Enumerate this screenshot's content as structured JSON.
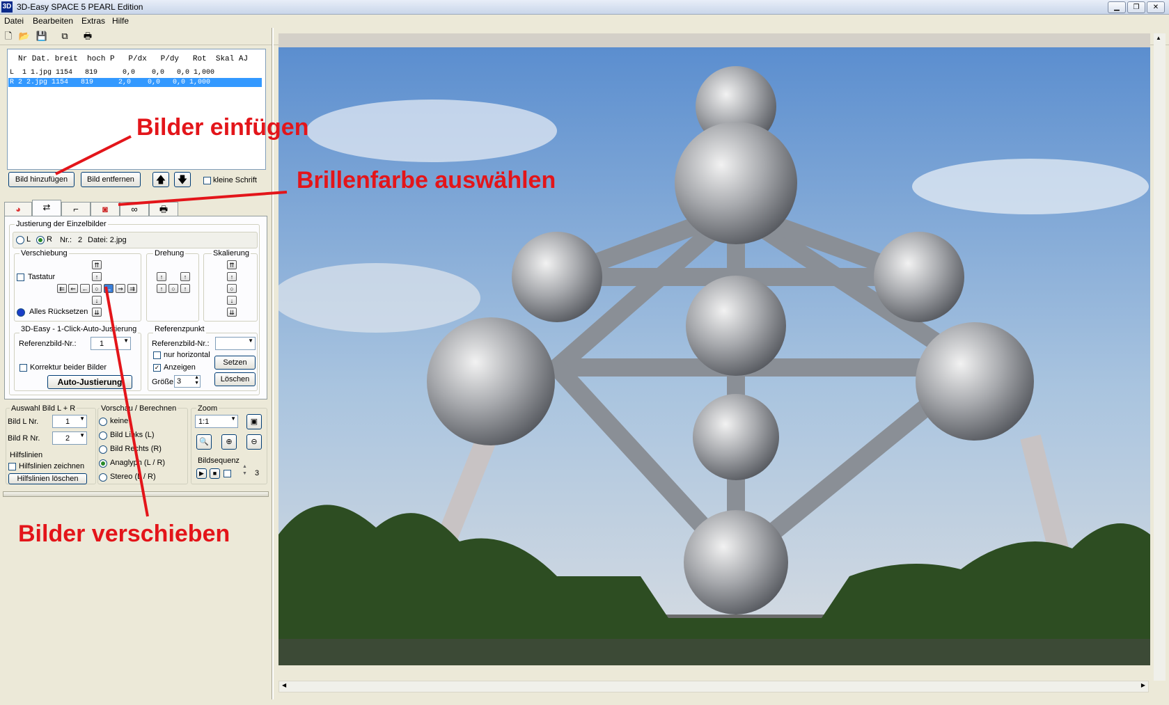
{
  "window": {
    "title": "3D-Easy SPACE 5 PEARL Edition",
    "icon_text": "3D",
    "controls": [
      "minimize-icon",
      "restore-icon",
      "close-icon"
    ]
  },
  "menu": [
    "Datei",
    "Bearbeiten",
    "Extras",
    "Hilfe"
  ],
  "toolbar": [
    "new-file-icon",
    "open-folder-icon",
    "save-icon",
    "copy-icon",
    "print-icon"
  ],
  "image_list": {
    "header": "Nr Dat. breit  hoch P   P/dx   P/dy   Rot  Skal AJ",
    "rows": [
      {
        "text": "L  1 1.jpg 1154   819      0,0    0,0   0,0 1,000",
        "selected": false
      },
      {
        "text": "R 2 2.jpg 1154   819      2,0    0,0   0,0 1,000",
        "selected": true
      }
    ]
  },
  "list_buttons": {
    "add": "Bild hinzufügen",
    "remove": "Bild entfernen",
    "small_font": "kleine Schrift"
  },
  "tabs": [
    "color-wheel-icon",
    "rotate-icon",
    "crop-icon",
    "glasses-icon",
    "stereo-icon",
    "print-icon"
  ],
  "justage": {
    "group": "Justierung der Einzelbilder",
    "radio_l": "L",
    "radio_r": "R",
    "nr_label": "Nr.:",
    "nr_value": "2",
    "file_label": "Datei: 2.jpg",
    "shift_label": "Verschiebung",
    "keyboard": "Tastatur",
    "reset_all": "Alles Rücksetzen",
    "rotation": "Drehung",
    "scaling": "Skalierung",
    "auto_group": "3D-Easy - 1-Click-Auto-Justierung",
    "ref_image_label": "Referenzbild-Nr.:",
    "ref_image_value": "1",
    "correct_both": "Korrektur beider Bilder",
    "auto_button": "Auto-Justierung",
    "refpoint_group": "Referenzpunkt",
    "ref2_label": "Referenzbild-Nr.:",
    "only_horizontal": "nur horizontal",
    "show": "Anzeigen",
    "size_label": "Größe",
    "size_value": "3",
    "set_button": "Setzen",
    "delete_button": "Löschen"
  },
  "selection": {
    "group": "Auswahl Bild L + R",
    "left_label": "Bild L  Nr.",
    "left_value": "1",
    "right_label": "Bild R  Nr.",
    "right_value": "2",
    "guides_group": "Hilfslinien",
    "guides_draw": "Hilfslinien zeichnen",
    "guides_clear": "Hilfslinien löschen"
  },
  "preview": {
    "group": "Vorschau / Berechnen",
    "options": [
      "keine",
      "Bild Links (L)",
      "Bild Rechts (R)",
      "Anaglyph (L / R)",
      "Stereo (L / R)"
    ],
    "selected": 3
  },
  "zoom": {
    "group": "Zoom",
    "value": "1:1",
    "sequence_group": "Bildsequenz",
    "sequence_value": "3"
  },
  "annotations": {
    "insert": "Bilder einfügen",
    "glasses": "Brillenfarbe auswählen",
    "shift": "Bilder verschieben",
    "color": "#e3151a"
  }
}
